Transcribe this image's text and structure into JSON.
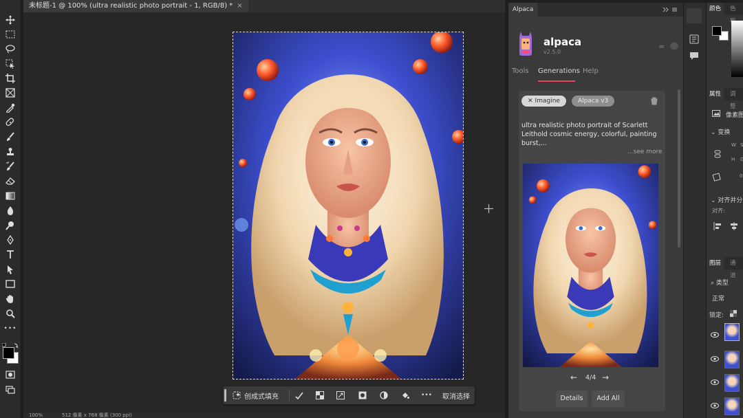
{
  "document": {
    "tab_title": "未标题-1 @ 100% (ultra realistic photo portrait - 1, RGB/8) *",
    "close_glyph": "×",
    "status_zoom": "100%",
    "status_info": "512 像素 x 768 像素 (300 ppi)"
  },
  "toolbar": {
    "tools": [
      "move-tool",
      "marquee-tool",
      "lasso-tool",
      "object-select-tool",
      "crop-tool",
      "frame-tool",
      "eyedropper-tool",
      "spot-heal-tool",
      "brush-tool",
      "stamp-tool",
      "history-brush-tool",
      "eraser-tool",
      "gradient-tool",
      "blur-tool",
      "dodge-tool",
      "pen-tool",
      "type-tool",
      "path-select-tool",
      "rectangle-tool",
      "hand-tool",
      "zoom-tool",
      "more-tools"
    ]
  },
  "contextual_bar": {
    "generative_fill": "创成式填充",
    "deselect": "取消选择",
    "more_glyph": "•••"
  },
  "plugin_panel": {
    "tab_label": "Alpaca",
    "app_name": "alpaca",
    "version": "v2.5.0",
    "nav": [
      "Tools",
      "Generations",
      "Help"
    ],
    "active_nav": "Generations",
    "chips": {
      "imagine": "Imagine",
      "model": "Alpaca v3"
    },
    "prompt": "ultra realistic photo portrait of Scarlett Leithold cosmic energy, colorful, painting burst,...",
    "see_more": "...see more",
    "pager": {
      "current": 4,
      "total": 4,
      "label": "4/4",
      "prev_glyph": "←",
      "next_glyph": "→"
    },
    "buttons": {
      "details": "Details",
      "add_all": "Add All"
    },
    "accent_color": "#e8445c"
  },
  "right_panel": {
    "tabs_top": [
      "颜色",
      "色板"
    ],
    "tabs_props": [
      "属性",
      "调整"
    ],
    "pixel_layer": "像素图",
    "transform": "变换",
    "w_label": "W",
    "h_label": "H",
    "s_label": "S",
    "g_label": "G",
    "align": "对齐并分",
    "align_sub": "对齐:",
    "tabs_layers": [
      "图层",
      "通道"
    ],
    "filter_kind": "类型",
    "blend_mode": "正常",
    "lock_label": "锁定:",
    "layer_count": 4
  },
  "colors": {
    "foreground": "#000000",
    "background": "#ffffff"
  }
}
